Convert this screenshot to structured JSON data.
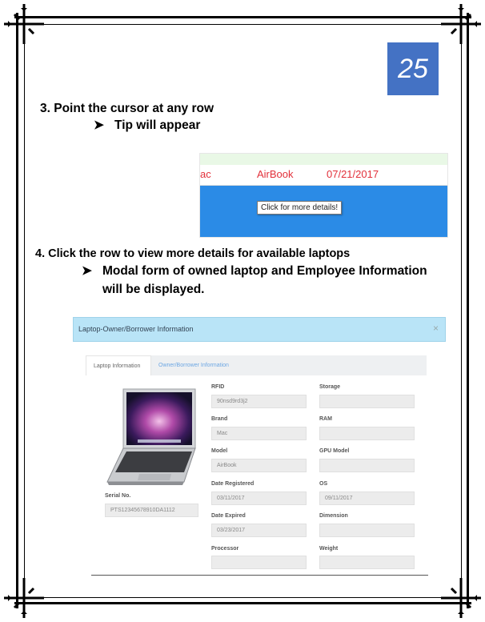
{
  "page_number": "25",
  "step3": {
    "title": "3. Point the cursor at any row",
    "tip": "Tip will appear"
  },
  "hover_screenshot": {
    "cells": [
      "ac",
      "AirBook",
      "07/21/2017"
    ],
    "tooltip": "Click for more details!",
    "colors": {
      "row_text": "#e2303a",
      "band": "#2b8be6"
    }
  },
  "step4": {
    "title": "4. Click the row to view more details for available laptops",
    "bullet_line1": "Modal form of owned laptop and Employee Information",
    "bullet_line2": "will be displayed."
  },
  "modal": {
    "title": "Laptop-Owner/Borrower Information",
    "close": "×",
    "tabs": [
      "Laptop Information",
      "Owner/Borrower Information"
    ],
    "serial_label": "Serial No.",
    "serial_value": "PTS12345678910DA1112",
    "left_fields": [
      {
        "label": "RFID",
        "value": "90nsd9rd3j2"
      },
      {
        "label": "Brand",
        "value": "Mac"
      },
      {
        "label": "Model",
        "value": "AirBook"
      },
      {
        "label": "Date Registered",
        "value": "03/11/2017"
      },
      {
        "label": "Date Expired",
        "value": "03/23/2017"
      },
      {
        "label": "Processor",
        "value": ""
      }
    ],
    "right_fields": [
      {
        "label": "Storage",
        "value": ""
      },
      {
        "label": "RAM",
        "value": ""
      },
      {
        "label": "GPU Model",
        "value": ""
      },
      {
        "label": "OS",
        "value": "09/11/2017"
      },
      {
        "label": "Dimension",
        "value": ""
      },
      {
        "label": "Weight",
        "value": ""
      }
    ]
  }
}
